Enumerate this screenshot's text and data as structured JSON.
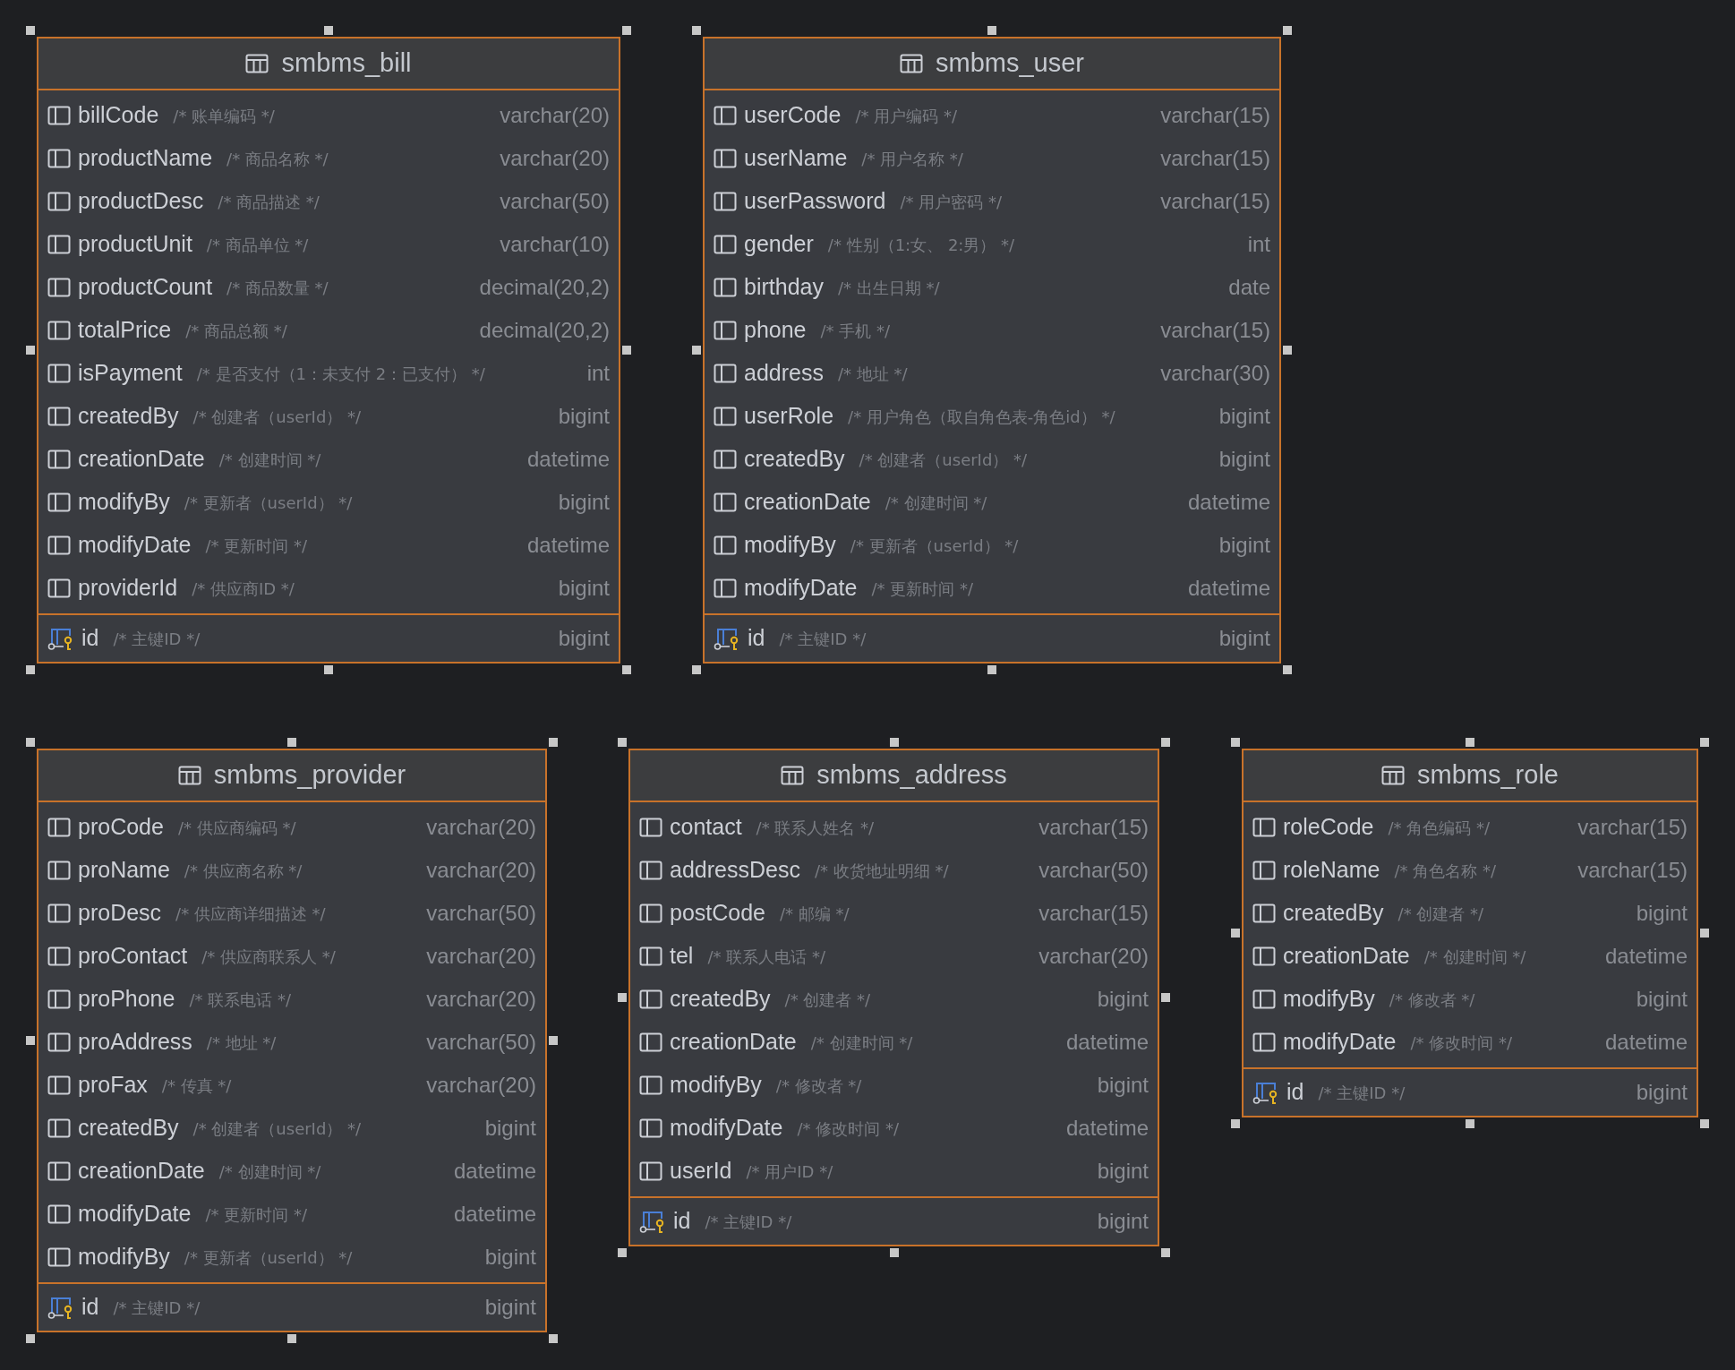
{
  "tables": [
    {
      "name": "smbms_bill",
      "selected": true,
      "columns": [
        {
          "name": "billCode",
          "comment": "/* 账单编码 */",
          "type": "varchar(20)"
        },
        {
          "name": "productName",
          "comment": "/* 商品名称 */",
          "type": "varchar(20)"
        },
        {
          "name": "productDesc",
          "comment": "/* 商品描述 */",
          "type": "varchar(50)"
        },
        {
          "name": "productUnit",
          "comment": "/* 商品单位 */",
          "type": "varchar(10)"
        },
        {
          "name": "productCount",
          "comment": "/* 商品数量 */",
          "type": "decimal(20,2)"
        },
        {
          "name": "totalPrice",
          "comment": "/* 商品总额 */",
          "type": "decimal(20,2)"
        },
        {
          "name": "isPayment",
          "comment": "/* 是否支付（1：未支付 2：已支付） */",
          "type": "int"
        },
        {
          "name": "createdBy",
          "comment": "/* 创建者（userId） */",
          "type": "bigint"
        },
        {
          "name": "creationDate",
          "comment": "/* 创建时间 */",
          "type": "datetime"
        },
        {
          "name": "modifyBy",
          "comment": "/* 更新者（userId） */",
          "type": "bigint"
        },
        {
          "name": "modifyDate",
          "comment": "/* 更新时间 */",
          "type": "datetime"
        },
        {
          "name": "providerId",
          "comment": "/* 供应商ID */",
          "type": "bigint"
        }
      ],
      "key_columns": [
        {
          "name": "id",
          "comment": "/* 主键ID */",
          "type": "bigint"
        }
      ]
    },
    {
      "name": "smbms_user",
      "selected": true,
      "columns": [
        {
          "name": "userCode",
          "comment": "/* 用户编码 */",
          "type": "varchar(15)"
        },
        {
          "name": "userName",
          "comment": "/* 用户名称 */",
          "type": "varchar(15)"
        },
        {
          "name": "userPassword",
          "comment": "/* 用户密码 */",
          "type": "varchar(15)"
        },
        {
          "name": "gender",
          "comment": "/* 性别（1:女、 2:男） */",
          "type": "int"
        },
        {
          "name": "birthday",
          "comment": "/* 出生日期 */",
          "type": "date"
        },
        {
          "name": "phone",
          "comment": "/* 手机 */",
          "type": "varchar(15)"
        },
        {
          "name": "address",
          "comment": "/* 地址 */",
          "type": "varchar(30)"
        },
        {
          "name": "userRole",
          "comment": "/* 用户角色（取自角色表-角色id） */",
          "type": "bigint"
        },
        {
          "name": "createdBy",
          "comment": "/* 创建者（userId） */",
          "type": "bigint"
        },
        {
          "name": "creationDate",
          "comment": "/* 创建时间 */",
          "type": "datetime"
        },
        {
          "name": "modifyBy",
          "comment": "/* 更新者（userId） */",
          "type": "bigint"
        },
        {
          "name": "modifyDate",
          "comment": "/* 更新时间 */",
          "type": "datetime"
        }
      ],
      "key_columns": [
        {
          "name": "id",
          "comment": "/* 主键ID */",
          "type": "bigint"
        }
      ]
    },
    {
      "name": "smbms_provider",
      "selected": true,
      "columns": [
        {
          "name": "proCode",
          "comment": "/* 供应商编码 */",
          "type": "varchar(20)"
        },
        {
          "name": "proName",
          "comment": "/* 供应商名称 */",
          "type": "varchar(20)"
        },
        {
          "name": "proDesc",
          "comment": "/* 供应商详细描述 */",
          "type": "varchar(50)"
        },
        {
          "name": "proContact",
          "comment": "/* 供应商联系人 */",
          "type": "varchar(20)"
        },
        {
          "name": "proPhone",
          "comment": "/* 联系电话 */",
          "type": "varchar(20)"
        },
        {
          "name": "proAddress",
          "comment": "/* 地址 */",
          "type": "varchar(50)"
        },
        {
          "name": "proFax",
          "comment": "/* 传真 */",
          "type": "varchar(20)"
        },
        {
          "name": "createdBy",
          "comment": "/* 创建者（userId） */",
          "type": "bigint"
        },
        {
          "name": "creationDate",
          "comment": "/* 创建时间 */",
          "type": "datetime"
        },
        {
          "name": "modifyDate",
          "comment": "/* 更新时间 */",
          "type": "datetime"
        },
        {
          "name": "modifyBy",
          "comment": "/* 更新者（userId） */",
          "type": "bigint"
        }
      ],
      "key_columns": [
        {
          "name": "id",
          "comment": "/* 主键ID */",
          "type": "bigint"
        }
      ]
    },
    {
      "name": "smbms_address",
      "selected": true,
      "columns": [
        {
          "name": "contact",
          "comment": "/* 联系人姓名 */",
          "type": "varchar(15)"
        },
        {
          "name": "addressDesc",
          "comment": "/* 收货地址明细 */",
          "type": "varchar(50)"
        },
        {
          "name": "postCode",
          "comment": "/* 邮编 */",
          "type": "varchar(15)"
        },
        {
          "name": "tel",
          "comment": "/* 联系人电话 */",
          "type": "varchar(20)"
        },
        {
          "name": "createdBy",
          "comment": "/* 创建者 */",
          "type": "bigint"
        },
        {
          "name": "creationDate",
          "comment": "/* 创建时间 */",
          "type": "datetime"
        },
        {
          "name": "modifyBy",
          "comment": "/* 修改者 */",
          "type": "bigint"
        },
        {
          "name": "modifyDate",
          "comment": "/* 修改时间 */",
          "type": "datetime"
        },
        {
          "name": "userId",
          "comment": "/* 用户ID */",
          "type": "bigint"
        }
      ],
      "key_columns": [
        {
          "name": "id",
          "comment": "/* 主键ID */",
          "type": "bigint"
        }
      ]
    },
    {
      "name": "smbms_role",
      "selected": true,
      "columns": [
        {
          "name": "roleCode",
          "comment": "/* 角色编码 */",
          "type": "varchar(15)"
        },
        {
          "name": "roleName",
          "comment": "/* 角色名称 */",
          "type": "varchar(15)"
        },
        {
          "name": "createdBy",
          "comment": "/* 创建者 */",
          "type": "bigint"
        },
        {
          "name": "creationDate",
          "comment": "/* 创建时间 */",
          "type": "datetime"
        },
        {
          "name": "modifyBy",
          "comment": "/* 修改者 */",
          "type": "bigint"
        },
        {
          "name": "modifyDate",
          "comment": "/* 修改时间 */",
          "type": "datetime"
        }
      ],
      "key_columns": [
        {
          "name": "id",
          "comment": "/* 主键ID */",
          "type": "bigint"
        }
      ]
    }
  ]
}
